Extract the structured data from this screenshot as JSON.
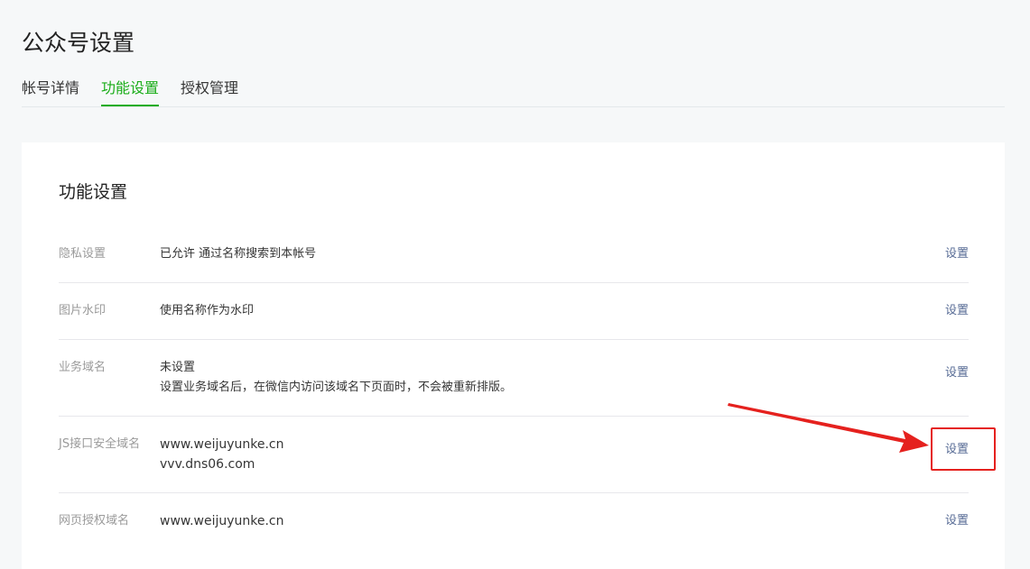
{
  "page": {
    "title": "公众号设置"
  },
  "tabs": [
    {
      "label": "帐号详情",
      "active": false
    },
    {
      "label": "功能设置",
      "active": true
    },
    {
      "label": "授权管理",
      "active": false
    }
  ],
  "section": {
    "title": "功能设置",
    "rows": [
      {
        "label": "隐私设置",
        "lines": [
          "已允许 通过名称搜索到本帐号"
        ],
        "action": "设置"
      },
      {
        "label": "图片水印",
        "lines": [
          "使用名称作为水印"
        ],
        "action": "设置"
      },
      {
        "label": "业务域名",
        "lines": [
          "未设置",
          "设置业务域名后，在微信内访问该域名下页面时，不会被重新排版。"
        ],
        "action": "设置"
      },
      {
        "label": "JS接口安全域名",
        "lines": [
          "www.weijuyunke.cn",
          "vvv.dns06.com"
        ],
        "action": "设置"
      },
      {
        "label": "网页授权域名",
        "lines": [
          "www.weijuyunke.cn"
        ],
        "action": "设置"
      }
    ]
  },
  "colors": {
    "accent": "#1aad19",
    "link": "#576b95",
    "annotation": "#e5211e"
  }
}
